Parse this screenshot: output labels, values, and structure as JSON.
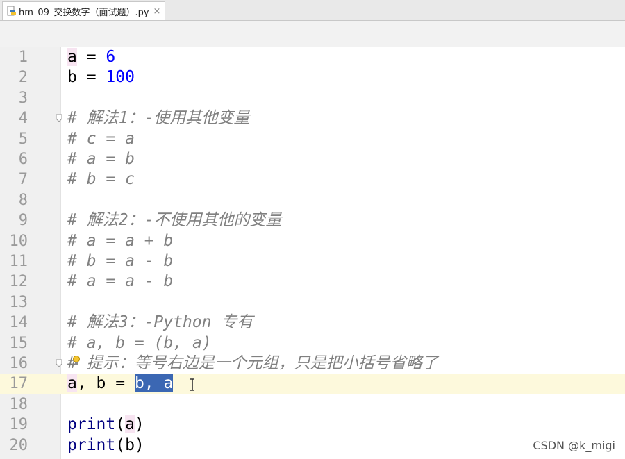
{
  "tab": {
    "filename": "hm_09_交换数字（面试题）.py",
    "close_glyph": "×"
  },
  "lines": [
    {
      "num": "1",
      "tokens": [
        {
          "t": "a",
          "c": "hl-var"
        },
        {
          "t": " = "
        },
        {
          "t": "6",
          "c": "num"
        }
      ]
    },
    {
      "num": "2",
      "tokens": [
        {
          "t": "b = "
        },
        {
          "t": "100",
          "c": "num"
        }
      ]
    },
    {
      "num": "3",
      "tokens": []
    },
    {
      "num": "4",
      "fold": true,
      "tokens": [
        {
          "t": "# 解法1：-使用其他变量",
          "c": "comment"
        }
      ]
    },
    {
      "num": "5",
      "tokens": [
        {
          "t": "# c = a",
          "c": "comment"
        }
      ]
    },
    {
      "num": "6",
      "tokens": [
        {
          "t": "# a = b",
          "c": "comment"
        }
      ]
    },
    {
      "num": "7",
      "tokens": [
        {
          "t": "# b = c",
          "c": "comment"
        }
      ]
    },
    {
      "num": "8",
      "tokens": []
    },
    {
      "num": "9",
      "tokens": [
        {
          "t": "# 解法2：-不使用其他的变量",
          "c": "comment"
        }
      ]
    },
    {
      "num": "10",
      "tokens": [
        {
          "t": "# a = a + b",
          "c": "comment"
        }
      ]
    },
    {
      "num": "11",
      "tokens": [
        {
          "t": "# b = a - b",
          "c": "comment"
        }
      ]
    },
    {
      "num": "12",
      "tokens": [
        {
          "t": "# a = a - b",
          "c": "comment"
        }
      ]
    },
    {
      "num": "13",
      "tokens": []
    },
    {
      "num": "14",
      "tokens": [
        {
          "t": "# 解法3：-Python 专有",
          "c": "comment"
        }
      ]
    },
    {
      "num": "15",
      "tokens": [
        {
          "t": "# a, b = (b, a)",
          "c": "comment"
        }
      ]
    },
    {
      "num": "16",
      "fold": true,
      "bulb": true,
      "tokens": [
        {
          "t": "# 提示：等号右边是一个元组，只是把小括号省略了",
          "c": "comment"
        }
      ]
    },
    {
      "num": "17",
      "current": true,
      "ibeam": true,
      "tokens": [
        {
          "t": "a",
          "c": "hl-var"
        },
        {
          "t": ", b = "
        },
        {
          "t": "b, a",
          "c": "sel"
        }
      ]
    },
    {
      "num": "18",
      "tokens": []
    },
    {
      "num": "19",
      "tokens": [
        {
          "t": "print",
          "c": "fn"
        },
        {
          "t": "("
        },
        {
          "t": "a",
          "c": "hl-var"
        },
        {
          "t": ")"
        }
      ]
    },
    {
      "num": "20",
      "tokens": [
        {
          "t": "print",
          "c": "fn"
        },
        {
          "t": "(b)"
        }
      ]
    }
  ],
  "watermark": "CSDN @k_migi",
  "colors": {
    "comment": "#808080",
    "number": "#0000ff",
    "function": "#000080",
    "selection": "#3b67b3",
    "current_line": "#fdf9dc",
    "gutter": "#f0f0f0"
  }
}
